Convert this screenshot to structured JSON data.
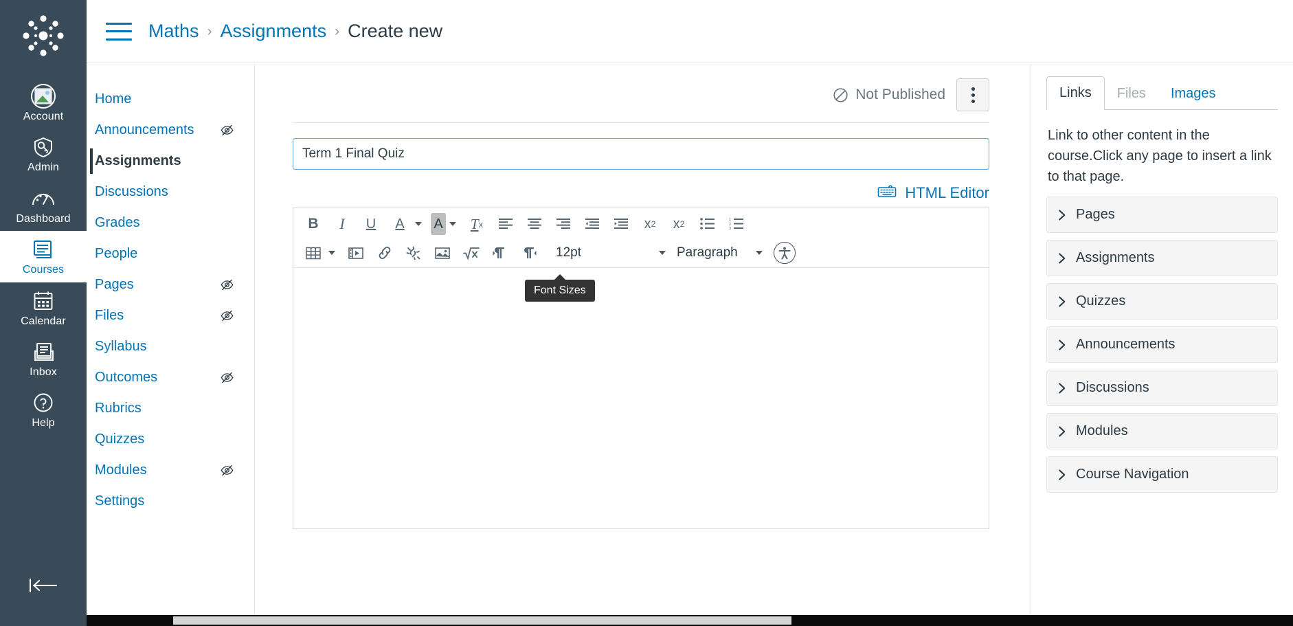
{
  "global_nav": {
    "logo_name": "canvas-logo",
    "items": [
      {
        "label": "Account",
        "icon": "avatar-icon",
        "active": false
      },
      {
        "label": "Admin",
        "icon": "shield-key-icon",
        "active": false
      },
      {
        "label": "Dashboard",
        "icon": "gauge-icon",
        "active": false
      },
      {
        "label": "Courses",
        "icon": "book-icon",
        "active": true
      },
      {
        "label": "Calendar",
        "icon": "calendar-icon",
        "active": false
      },
      {
        "label": "Inbox",
        "icon": "inbox-icon",
        "active": false
      },
      {
        "label": "Help",
        "icon": "question-circle-icon",
        "active": false
      }
    ],
    "collapse_label": "collapse-nav-icon"
  },
  "breadcrumb": {
    "menu_icon": "hamburger-icon",
    "items": [
      {
        "label": "Maths",
        "current": false
      },
      {
        "label": "Assignments",
        "current": false
      },
      {
        "label": "Create new",
        "current": true
      }
    ],
    "separator": "›"
  },
  "course_nav": {
    "items": [
      {
        "label": "Home",
        "hidden_icon": false,
        "active": false
      },
      {
        "label": "Announcements",
        "hidden_icon": true,
        "active": false
      },
      {
        "label": "Assignments",
        "hidden_icon": false,
        "active": true
      },
      {
        "label": "Discussions",
        "hidden_icon": false,
        "active": false
      },
      {
        "label": "Grades",
        "hidden_icon": false,
        "active": false
      },
      {
        "label": "People",
        "hidden_icon": false,
        "active": false
      },
      {
        "label": "Pages",
        "hidden_icon": true,
        "active": false
      },
      {
        "label": "Files",
        "hidden_icon": true,
        "active": false
      },
      {
        "label": "Syllabus",
        "hidden_icon": false,
        "active": false
      },
      {
        "label": "Outcomes",
        "hidden_icon": true,
        "active": false
      },
      {
        "label": "Rubrics",
        "hidden_icon": false,
        "active": false
      },
      {
        "label": "Quizzes",
        "hidden_icon": false,
        "active": false
      },
      {
        "label": "Modules",
        "hidden_icon": true,
        "active": false
      },
      {
        "label": "Settings",
        "hidden_icon": false,
        "active": false
      }
    ]
  },
  "main": {
    "publish_status": "Not Published",
    "publish_icon": "circle-slash-icon",
    "kebab_label": "more-options",
    "title_field": {
      "value": "Term 1 Final Quiz",
      "placeholder": "Title"
    },
    "html_editor_link": "HTML Editor",
    "html_editor_icon": "keyboard-icon",
    "tooltip": "Font Sizes"
  },
  "toolbar": {
    "row1": [
      {
        "name": "bold-button",
        "glyph": "B",
        "style": "bold"
      },
      {
        "name": "italic-button",
        "glyph": "I",
        "style": "italic"
      },
      {
        "name": "underline-button",
        "glyph": "U",
        "style": "underline"
      },
      {
        "name": "text-color-button",
        "glyph": "A",
        "style": "colorA",
        "caret": true
      },
      {
        "name": "highlight-color-button",
        "glyph": "A",
        "style": "highlightA",
        "caret": true
      },
      {
        "name": "clear-formatting-button",
        "glyph": "Tx",
        "style": "clear"
      },
      {
        "name": "align-left-button",
        "glyph": "align-left-icon",
        "style": "icon"
      },
      {
        "name": "align-center-button",
        "glyph": "align-center-icon",
        "style": "icon"
      },
      {
        "name": "align-right-button",
        "glyph": "align-right-icon",
        "style": "icon"
      },
      {
        "name": "outdent-button",
        "glyph": "outdent-icon",
        "style": "icon"
      },
      {
        "name": "indent-button",
        "glyph": "indent-icon",
        "style": "icon"
      },
      {
        "name": "superscript-button",
        "glyph": "x2-sup",
        "style": "sup"
      },
      {
        "name": "subscript-button",
        "glyph": "x2-sub",
        "style": "sub"
      },
      {
        "name": "bulleted-list-button",
        "glyph": "bullet-list-icon",
        "style": "icon"
      },
      {
        "name": "numbered-list-button",
        "glyph": "numbered-list-icon",
        "style": "icon"
      }
    ],
    "row2": [
      {
        "name": "table-button",
        "glyph": "table-icon",
        "caret": true
      },
      {
        "name": "media-button",
        "glyph": "media-icon"
      },
      {
        "name": "link-button",
        "glyph": "link-icon"
      },
      {
        "name": "unlink-button",
        "glyph": "unlink-icon"
      },
      {
        "name": "image-button",
        "glyph": "image-icon"
      },
      {
        "name": "math-button",
        "glyph": "sqrt-x-icon"
      },
      {
        "name": "ltr-button",
        "glyph": "paragraph-ltr-icon"
      },
      {
        "name": "rtl-button",
        "glyph": "paragraph-rtl-icon"
      }
    ],
    "font_size_value": "12pt",
    "paragraph_value": "Paragraph",
    "a11y_checker": "accessibility-checker-icon"
  },
  "sidebar": {
    "tabs": [
      {
        "label": "Links",
        "state": "active"
      },
      {
        "label": "Files",
        "state": "disabled"
      },
      {
        "label": "Images",
        "state": "link"
      }
    ],
    "description": "Link to other content in the course.Click any page to insert a link to that page.",
    "accordion": [
      {
        "label": "Pages"
      },
      {
        "label": "Assignments"
      },
      {
        "label": "Quizzes"
      },
      {
        "label": "Announcements"
      },
      {
        "label": "Discussions"
      },
      {
        "label": "Modules"
      },
      {
        "label": "Course Navigation"
      }
    ]
  },
  "colors": {
    "brand_blue": "#0374B5",
    "nav_dark": "#394B58",
    "text_dark": "#2D3B45",
    "muted": "#6B7780",
    "border": "#c7cdd1",
    "tooltip_bg": "#333333"
  }
}
